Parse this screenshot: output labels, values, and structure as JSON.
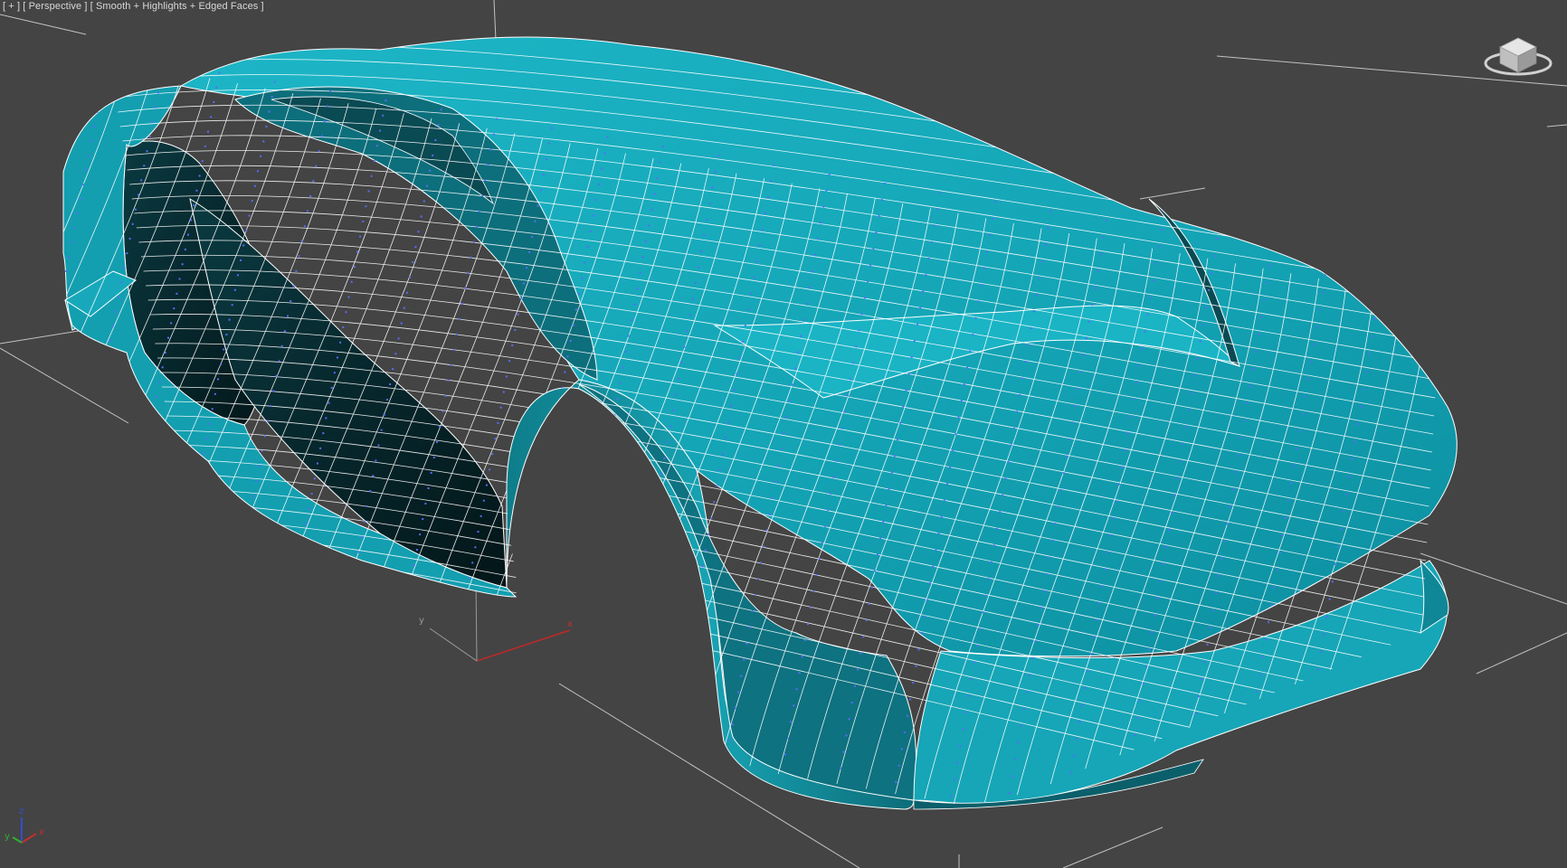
{
  "viewport": {
    "label_parts": [
      "[ + ]",
      " [ Perspective ]",
      " [ Smooth + Highlights + Edged Faces ]"
    ],
    "type": "Perspective",
    "shading": "Smooth + Highlights + Edged Faces",
    "background_color": "#444444",
    "grid_line_color": "#d8d8d8"
  },
  "model": {
    "surface_color": "#17a9bb",
    "shadow_color": "#0b5f6b",
    "dark_color": "#06262b",
    "edge_color": "#ffffff",
    "vertex_color": "#5a6bff"
  },
  "gizmo": {
    "world_axes": {
      "x": "x",
      "y": "y",
      "z": "z"
    },
    "corner_axes": {
      "x": "x",
      "y": "y",
      "z": "z"
    },
    "x_color": "#c03030",
    "y_color": "#30b030",
    "z_color": "#3050d0",
    "icons": [
      "viewcube-icon",
      "world-axis-tripod-icon",
      "axis-tripod-icon"
    ]
  }
}
